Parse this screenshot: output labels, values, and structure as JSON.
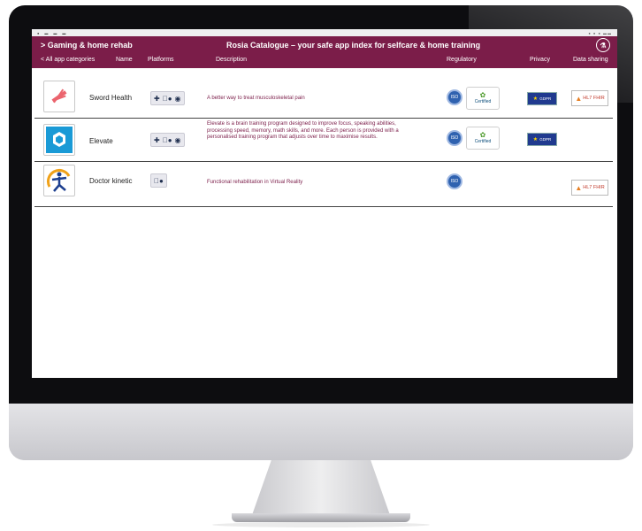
{
  "header": {
    "category": "> Gaming & home rehab",
    "title": "Rosia Catalogue – your safe app index  for selfcare & home training"
  },
  "columns": {
    "back": "< All app categories",
    "name": "Name",
    "platforms": "Platforms",
    "description": "Description",
    "regulatory": "Regulatory",
    "privacy": "Privacy",
    "data_sharing": "Data sharing"
  },
  "badges": {
    "iso": "ISO",
    "certified": "Certified",
    "gdpr": "GDPR",
    "hl7": "HL7 FHIR"
  },
  "apps": [
    {
      "name": "Sword Health",
      "description": "A better way to treat musculoskeletal pain"
    },
    {
      "name": "Elevate",
      "description": "Elevate is a brain training program designed to improve focus, speaking abilities, processing speed, memory, math skills, and more. Each person is provided with a personalised training program that adjusts over time to maximise results."
    },
    {
      "name": "Doctor kinetic",
      "description": "Functional rehabilitation in Virtual Reality"
    }
  ],
  "colors": {
    "brand": "#7b1d49",
    "elevate_blue": "#1a9ad6",
    "sword_red": "#e84a55",
    "iso_blue": "#2f62b0"
  },
  "icons": [
    "android-icon",
    "apple-icon",
    "web-icon",
    "logo-icon",
    "iso-icon",
    "gdpr-icon",
    "hl7-flame-icon"
  ]
}
